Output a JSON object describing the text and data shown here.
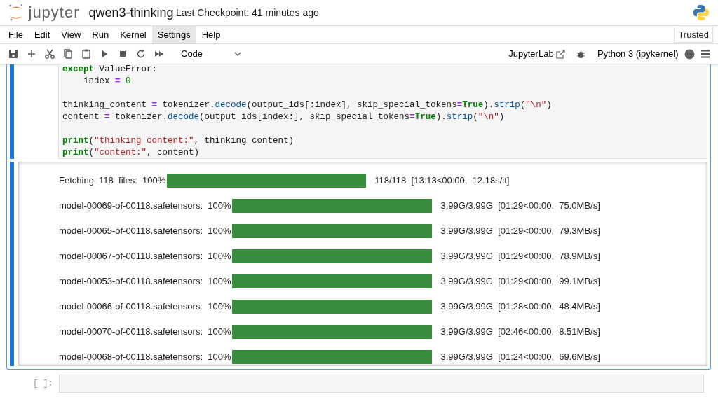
{
  "header": {
    "logo_text": "jupyter",
    "notebook_name": "qwen3-thinking",
    "checkpoint": "Last Checkpoint: 41 minutes ago"
  },
  "menu": [
    {
      "label": "File",
      "selected": false
    },
    {
      "label": "Edit",
      "selected": false
    },
    {
      "label": "View",
      "selected": false
    },
    {
      "label": "Run",
      "selected": false
    },
    {
      "label": "Kernel",
      "selected": false
    },
    {
      "label": "Settings",
      "selected": true
    },
    {
      "label": "Help",
      "selected": false
    }
  ],
  "trusted": "Trusted",
  "toolbar": {
    "cell_type": "Code",
    "jupyterlab": "JupyterLab",
    "kernel": "Python 3 (ipykernel)",
    "kernel_busy": false
  },
  "code_blocks": [
    [
      [
        {
          "t": "except",
          "kind": "kw"
        },
        {
          "t": " ValueError:",
          "kind": "plain"
        }
      ],
      [
        {
          "t": "    index ",
          "kind": "plain"
        },
        {
          "t": "=",
          "kind": "op"
        },
        {
          "t": " 0",
          "kind": "num"
        }
      ]
    ],
    [
      [
        {
          "t": "thinking_content ",
          "kind": "plain"
        },
        {
          "t": "=",
          "kind": "op"
        },
        {
          "t": " tokenizer.",
          "kind": "plain"
        },
        {
          "t": "decode",
          "kind": "fn"
        },
        {
          "t": "(output_ids[:index], skip_special_tokens",
          "kind": "plain"
        },
        {
          "t": "=",
          "kind": "op"
        },
        {
          "t": "True",
          "kind": "kw"
        },
        {
          "t": ").",
          "kind": "plain"
        },
        {
          "t": "strip",
          "kind": "fn"
        },
        {
          "t": "(",
          "kind": "plain"
        },
        {
          "t": "\"\\n\"",
          "kind": "str"
        },
        {
          "t": ")",
          "kind": "plain"
        }
      ],
      [
        {
          "t": "content ",
          "kind": "plain"
        },
        {
          "t": "=",
          "kind": "op"
        },
        {
          "t": " tokenizer.",
          "kind": "plain"
        },
        {
          "t": "decode",
          "kind": "fn"
        },
        {
          "t": "(output_ids[index:], skip_special_tokens",
          "kind": "plain"
        },
        {
          "t": "=",
          "kind": "op"
        },
        {
          "t": "True",
          "kind": "kw"
        },
        {
          "t": ").",
          "kind": "plain"
        },
        {
          "t": "strip",
          "kind": "fn"
        },
        {
          "t": "(",
          "kind": "plain"
        },
        {
          "t": "\"\\n\"",
          "kind": "str"
        },
        {
          "t": ")",
          "kind": "plain"
        }
      ]
    ],
    [
      [
        {
          "t": "print",
          "kind": "kw"
        },
        {
          "t": "(",
          "kind": "plain"
        },
        {
          "t": "\"thinking content:\"",
          "kind": "str"
        },
        {
          "t": ", thinking_content)",
          "kind": "plain"
        }
      ],
      [
        {
          "t": "print",
          "kind": "kw"
        },
        {
          "t": "(",
          "kind": "plain"
        },
        {
          "t": "\"content:\"",
          "kind": "str"
        },
        {
          "t": ", content)",
          "kind": "plain"
        }
      ]
    ]
  ],
  "progress": [
    {
      "label": "Fetching  118  files:  100%",
      "level": 1,
      "info": "118/118  [13:13<00:00,  12.18s/it]",
      "kind": "fetch"
    },
    {
      "label": "model-00069-of-00118.safetensors:  100%",
      "level": 1,
      "info": "3.99G/3.99G  [01:29<00:00,  75.0MB/s]",
      "kind": "file"
    },
    {
      "label": "model-00065-of-00118.safetensors:  100%",
      "level": 1,
      "info": "3.99G/3.99G  [01:29<00:00,  79.3MB/s]",
      "kind": "file"
    },
    {
      "label": "model-00067-of-00118.safetensors:  100%",
      "level": 1,
      "info": "3.99G/3.99G  [01:29<00:00,  78.9MB/s]",
      "kind": "file"
    },
    {
      "label": "model-00053-of-00118.safetensors:  100%",
      "level": 1,
      "info": "3.99G/3.99G  [01:29<00:00,  99.1MB/s]",
      "kind": "file"
    },
    {
      "label": "model-00066-of-00118.safetensors:  100%",
      "level": 1,
      "info": "3.99G/3.99G  [01:28<00:00,  48.4MB/s]",
      "kind": "file"
    },
    {
      "label": "model-00070-of-00118.safetensors:  100%",
      "level": 1,
      "info": "3.99G/3.99G  [02:46<00:00,  8.51MB/s]",
      "kind": "file"
    },
    {
      "label": "model-00068-of-00118.safetensors:  100%",
      "level": 1,
      "info": "3.99G/3.99G  [01:24<00:00,  69.6MB/s]",
      "kind": "file"
    }
  ],
  "empty_cell": {
    "prompt": "[ ]:"
  }
}
